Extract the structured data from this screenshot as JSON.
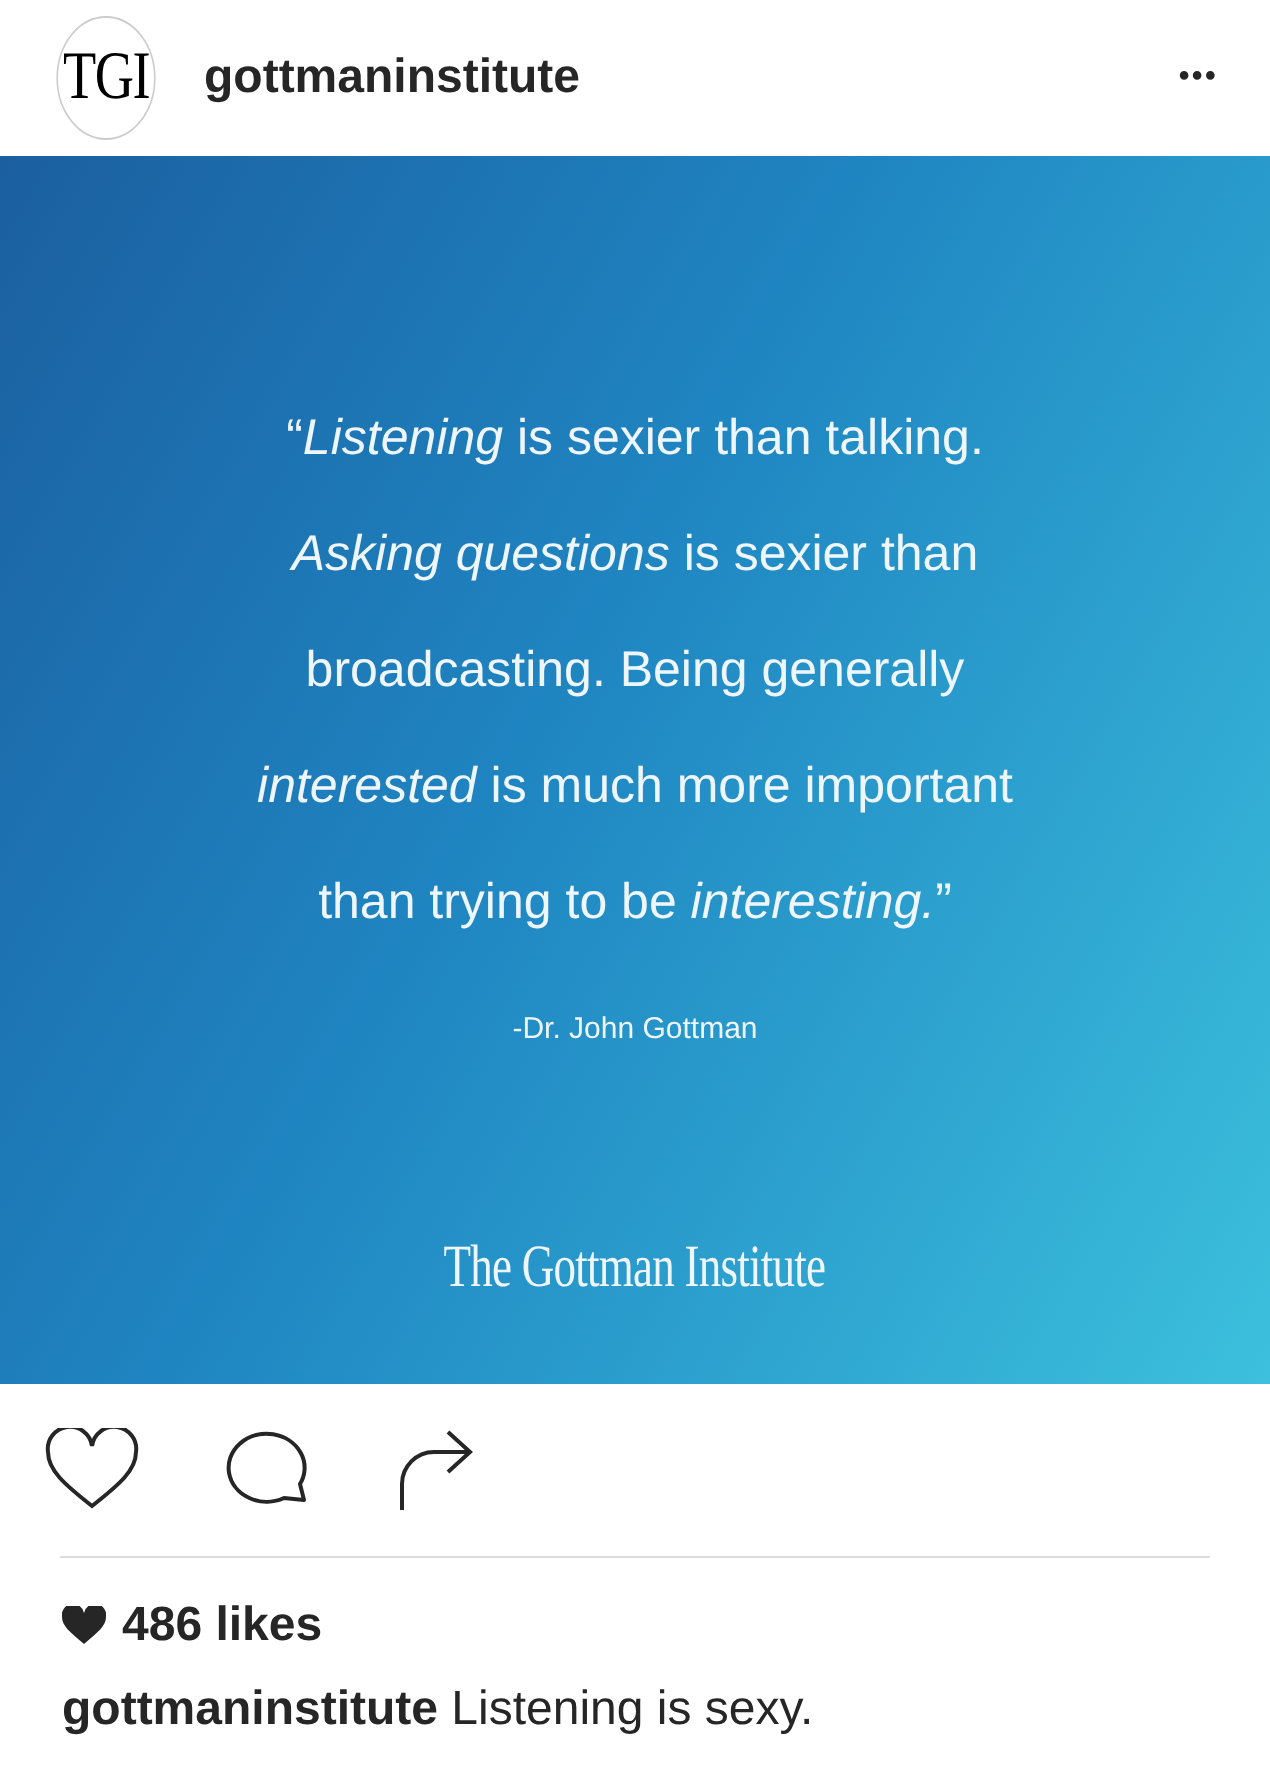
{
  "post": {
    "avatar_text": "TGI",
    "username": "gottmaninstitute",
    "menu": "•••"
  },
  "quote_card": {
    "lines": [
      "“*Listening* is sexier than talking.",
      "*Asking questions* is sexier than",
      "broadcasting. Being generally",
      "*interested* is much more important",
      "than trying to be *interesting.*”"
    ],
    "author": "-Dr. John Gottman",
    "brand": "The Gottman Institute"
  },
  "likes": "486 likes",
  "caption": "**gottmaninstitute** Listening is sexy."
}
